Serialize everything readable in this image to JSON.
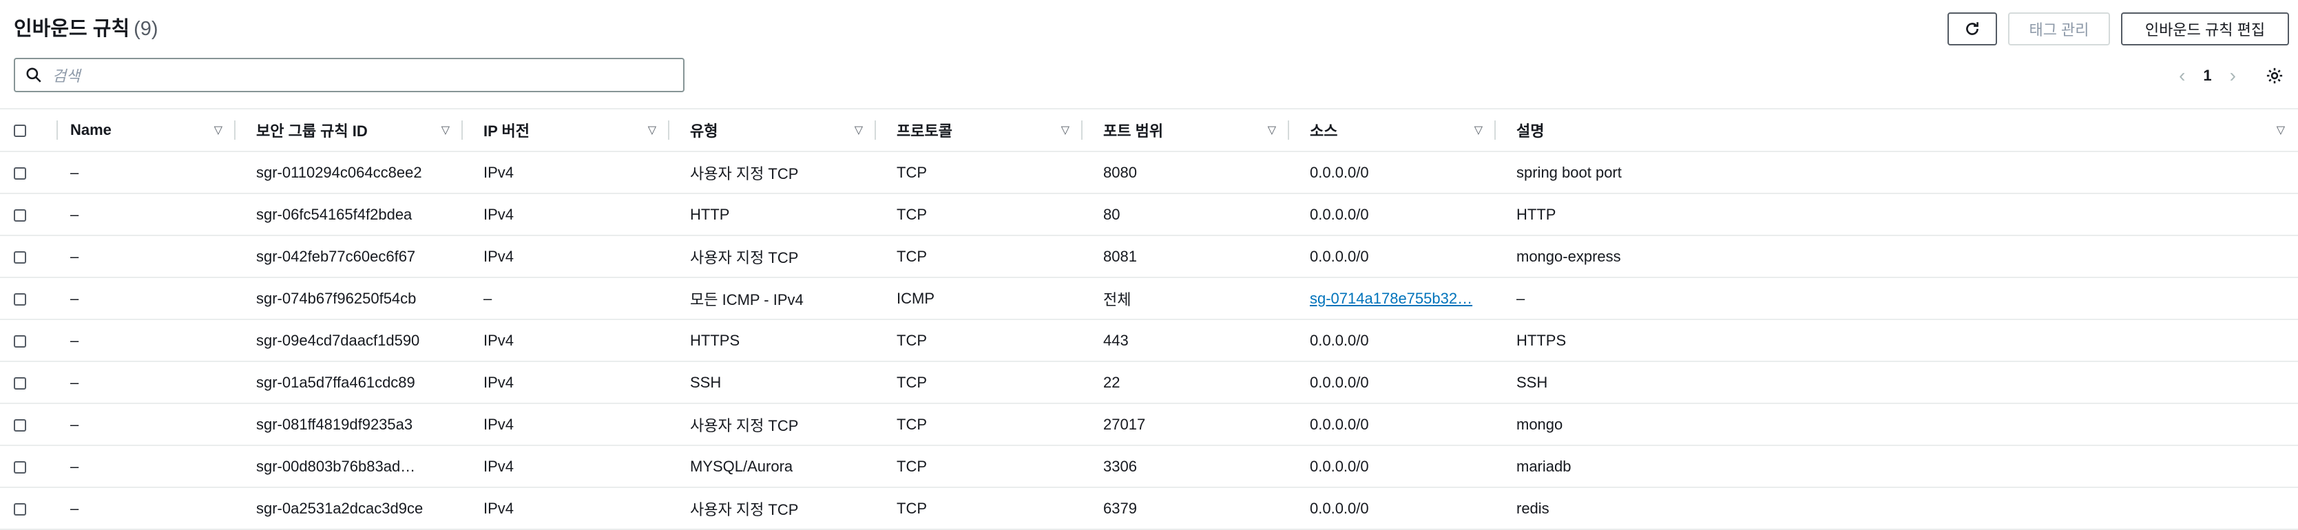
{
  "header": {
    "title": "인바운드 규칙",
    "count": "(9)",
    "refresh_icon": "refresh-icon",
    "manage_tags_label": "태그 관리",
    "edit_rules_label": "인바운드 규칙 편집"
  },
  "search": {
    "placeholder": "검색",
    "icon": "search-icon"
  },
  "pagination": {
    "current_page": "1",
    "prev_icon": "chevron-left-icon",
    "next_icon": "chevron-right-icon",
    "settings_icon": "gear-icon"
  },
  "table": {
    "columns": [
      "Name",
      "보안 그룹 규칙 ID",
      "IP 버전",
      "유형",
      "프로토콜",
      "포트 범위",
      "소스",
      "설명"
    ],
    "rows": [
      {
        "name": "–",
        "rule_id": "sgr-0110294c064cc8ee2",
        "ip_version": "IPv4",
        "type": "사용자 지정 TCP",
        "protocol": "TCP",
        "port_range": "8080",
        "source": "0.0.0.0/0",
        "description": "spring boot port"
      },
      {
        "name": "–",
        "rule_id": "sgr-06fc54165f4f2bdea",
        "ip_version": "IPv4",
        "type": "HTTP",
        "protocol": "TCP",
        "port_range": "80",
        "source": "0.0.0.0/0",
        "description": "HTTP"
      },
      {
        "name": "–",
        "rule_id": "sgr-042feb77c60ec6f67",
        "ip_version": "IPv4",
        "type": "사용자 지정 TCP",
        "protocol": "TCP",
        "port_range": "8081",
        "source": "0.0.0.0/0",
        "description": "mongo-express"
      },
      {
        "name": "–",
        "rule_id": "sgr-074b67f96250f54cb",
        "ip_version": "–",
        "type": "모든 ICMP - IPv4",
        "protocol": "ICMP",
        "port_range": "전체",
        "source": "sg-0714a178e755b32…",
        "description": "–"
      },
      {
        "name": "–",
        "rule_id": "sgr-09e4cd7daacf1d590",
        "ip_version": "IPv4",
        "type": "HTTPS",
        "protocol": "TCP",
        "port_range": "443",
        "source": "0.0.0.0/0",
        "description": "HTTPS"
      },
      {
        "name": "–",
        "rule_id": "sgr-01a5d7ffa461cdc89",
        "ip_version": "IPv4",
        "type": "SSH",
        "protocol": "TCP",
        "port_range": "22",
        "source": "0.0.0.0/0",
        "description": "SSH"
      },
      {
        "name": "–",
        "rule_id": "sgr-081ff4819df9235a3",
        "ip_version": "IPv4",
        "type": "사용자 지정 TCP",
        "protocol": "TCP",
        "port_range": "27017",
        "source": "0.0.0.0/0",
        "description": "mongo"
      },
      {
        "name": "–",
        "rule_id": "sgr-00d803b76b83ad…",
        "ip_version": "IPv4",
        "type": "MYSQL/Aurora",
        "protocol": "TCP",
        "port_range": "3306",
        "source": "0.0.0.0/0",
        "description": "mariadb"
      },
      {
        "name": "–",
        "rule_id": "sgr-0a2531a2dcac3d9ce",
        "ip_version": "IPv4",
        "type": "사용자 지정 TCP",
        "protocol": "TCP",
        "port_range": "6379",
        "source": "0.0.0.0/0",
        "description": "redis"
      }
    ]
  },
  "colors": {
    "link": "#0073bb",
    "border": "#eaeded",
    "text": "#16191f"
  }
}
